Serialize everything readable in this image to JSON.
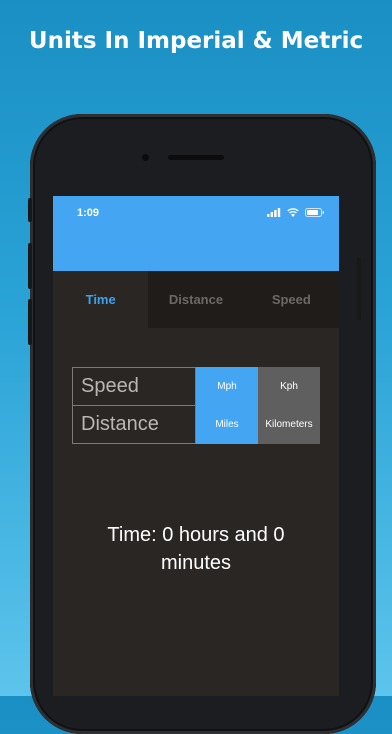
{
  "headline": "Units In Imperial & Metric",
  "status": {
    "time": "1:09"
  },
  "tabs": [
    {
      "label": "Time",
      "active": true
    },
    {
      "label": "Distance",
      "active": false
    },
    {
      "label": "Speed",
      "active": false
    }
  ],
  "grid": {
    "row_labels": [
      "Speed",
      "Distance"
    ],
    "imperial": [
      "Mph",
      "Miles"
    ],
    "metric": [
      "Kph",
      "Kilometers"
    ]
  },
  "result": {
    "line1": "Time: 0 hours and 0",
    "line2": "minutes"
  },
  "colors": {
    "accent": "#44a6f2",
    "active_tab_text": "#3fa1ee",
    "screen_bg": "#2a2623",
    "metric_bg": "#5f5f5f"
  }
}
